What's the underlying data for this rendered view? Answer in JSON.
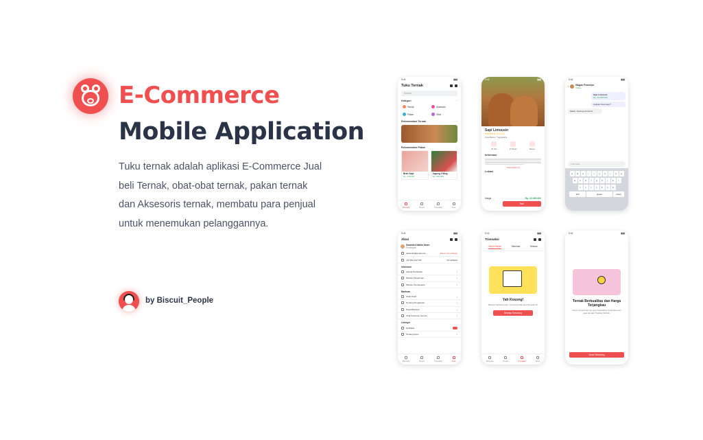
{
  "hero": {
    "title_line1": "E-Commerce",
    "title_line2": "Mobile Application",
    "description": "Tuku ternak adalah aplikasi E-Commerce Jual beli Ternak, obat-obat ternak, pakan ternak dan Aksesoris ternak, membatu para penjual untuk menemukan pelanggannya.",
    "author": "by Biscuit_People"
  },
  "colors": {
    "accent": "#ef4f4f",
    "heading": "#2b3447",
    "price": "#2cab5a"
  },
  "home": {
    "time": "9:41",
    "title": "Tuku Ternak",
    "search_placeholder": "Search",
    "kategori": "Kategori",
    "categories": [
      "Ternak",
      "Aksesoris",
      "Pakan",
      "Obat"
    ],
    "rekomendasi_ternak": "Rekomendasi Ternak",
    "rekomendasi_pakan": "Rekomendasi Pakan",
    "products": [
      {
        "name": "Bran Sapi",
        "price": "Rp. 245.000"
      },
      {
        "name": "Jagung Giling",
        "price": "Rp. 155.000"
      }
    ]
  },
  "tabs": [
    "Beranda",
    "Pesan",
    "Transaksi",
    "Akun"
  ],
  "detail": {
    "time": "9:41",
    "name": "Sapi Limousin",
    "rating": "★★★★★ 4.0 (72)",
    "location": "Kota Bantul, Yogyakarta",
    "actions": [
      "20 Kilo",
      "10 Bulan",
      "Betina"
    ],
    "info_title": "Informasi",
    "more": "Selengkapnya",
    "lokasi": "Lokasi",
    "price_label": "Harga",
    "price": "Rp. 42.000.000",
    "buy": "Beli"
  },
  "chat": {
    "time": "9:41",
    "name": "Bagas Prasetyo",
    "status": "Online",
    "msg1": "Sapi Limousin",
    "msg1_price": "Rp. 42.000.000",
    "msg2": "Apakah bisa nego?",
    "msg3": "Masih, Stoknya di Kartu?",
    "input_placeholder": "Tulis disini",
    "keys_row1": [
      "q",
      "w",
      "e",
      "r",
      "t",
      "y",
      "u",
      "i",
      "o",
      "p"
    ],
    "keys_row2": [
      "a",
      "s",
      "d",
      "f",
      "g",
      "h",
      "j",
      "k",
      "l"
    ],
    "keys_row3": [
      "z",
      "x",
      "c",
      "v",
      "b",
      "n",
      "m"
    ],
    "space": "space",
    "return": "return"
  },
  "akun": {
    "time": "9:41",
    "title": "Akun",
    "name": "Sasandra Nabila Ibrani",
    "role": "Pembayar",
    "email": "sasandra@gmail.com",
    "email_status": "Belum Terverifikasi",
    "phone": "+62 822 012 020",
    "phone_status": "Terverifikasi",
    "sec_info": "Informasi",
    "info_items": [
      "Alamat Pembelian",
      "Metode Pengiriman",
      "Metode Pembayaran"
    ],
    "sec_bantuan": "Bantuan",
    "bantuan_items": [
      "Ubah Profil",
      "Tentang Pengaturan",
      "Pusat Bantuan",
      "Chat Customer Service"
    ],
    "sec_lainnya": "Lainnya",
    "lainnya_items": [
      "Notifikasi",
      "Tentang Kami"
    ]
  },
  "transaksi": {
    "time": "9:41",
    "title": "Transaksi",
    "tabs": [
      "Belum Bayar",
      "Dikemas",
      "Selesai"
    ],
    "empty_title": "Yah Kosong!",
    "empty_sub": "Belanja Sekarang ajo, mumpung ada yang Spesial Ini!",
    "cta": "Belanja Sekarang"
  },
  "onboard": {
    "time": "9:41",
    "title": "Ternak Berkualitas dan Harga Terjangkau",
    "sub": "Kami menjual Ternak yang berkualitas Terjamkau dan juga dengan Kualitas Terbaik.",
    "cta": "Mulai Sekarang"
  }
}
